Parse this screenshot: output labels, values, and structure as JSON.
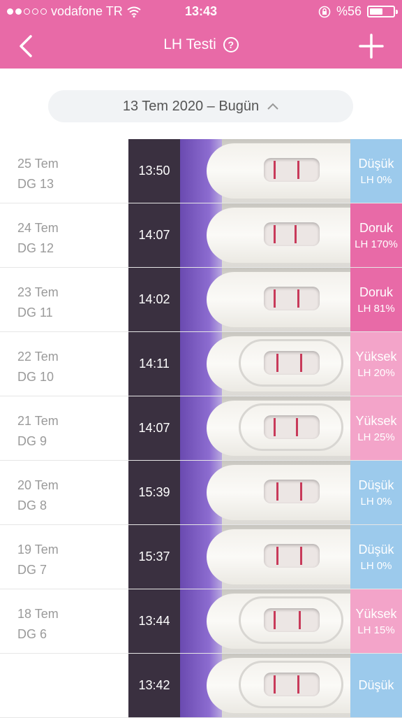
{
  "status": {
    "carrier": "vodafone TR",
    "time": "13:43",
    "battery": "%56",
    "battery_level": 0.56
  },
  "nav": {
    "title": "LH Testi"
  },
  "date_range": "13 Tem 2020 – Bugün",
  "rows": [
    {
      "date": "25 Tem",
      "cycle": "DG 13",
      "time": "13:50",
      "result": "Düşük",
      "lh": "LH 0%",
      "level": "low"
    },
    {
      "date": "24 Tem",
      "cycle": "DG 12",
      "time": "14:07",
      "result": "Doruk",
      "lh": "LH 170%",
      "level": "peak"
    },
    {
      "date": "23 Tem",
      "cycle": "DG 11",
      "time": "14:02",
      "result": "Doruk",
      "lh": "LH 81%",
      "level": "peak"
    },
    {
      "date": "22 Tem",
      "cycle": "DG 10",
      "time": "14:11",
      "result": "Yüksek",
      "lh": "LH 20%",
      "level": "high"
    },
    {
      "date": "21 Tem",
      "cycle": "DG 9",
      "time": "14:07",
      "result": "Yüksek",
      "lh": "LH 25%",
      "level": "high"
    },
    {
      "date": "20 Tem",
      "cycle": "DG 8",
      "time": "15:39",
      "result": "Düşük",
      "lh": "LH 0%",
      "level": "low"
    },
    {
      "date": "19 Tem",
      "cycle": "DG 7",
      "time": "15:37",
      "result": "Düşük",
      "lh": "LH 0%",
      "level": "low"
    },
    {
      "date": "18 Tem",
      "cycle": "DG 6",
      "time": "13:44",
      "result": "Yüksek",
      "lh": "LH 15%",
      "level": "high"
    },
    {
      "date": "",
      "cycle": "",
      "time": "13:42",
      "result": "Düşük",
      "lh": "",
      "level": "low"
    }
  ],
  "colors": {
    "header": "#e86aa7",
    "low": "#9ccaec",
    "peak": "#e86aa7",
    "high": "#f3a4c9"
  }
}
